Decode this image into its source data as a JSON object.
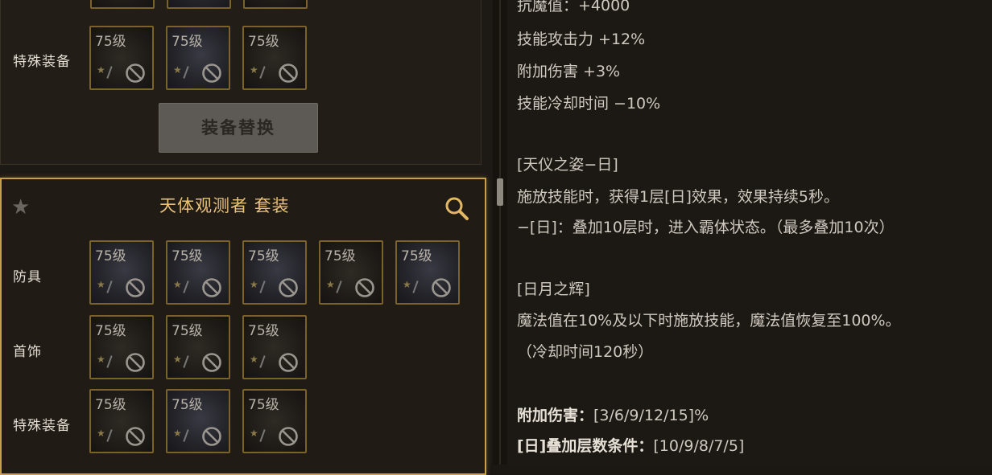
{
  "left_top": {
    "special_label": "特殊装备",
    "special_slots": [
      "75级",
      "75级",
      "75级"
    ],
    "swap_button": "装备替换"
  },
  "set_panel": {
    "title": "天体观测者 套装",
    "armor_label": "防具",
    "armor_slots": [
      "75级",
      "75级",
      "75级",
      "75级",
      "75级"
    ],
    "accessory_label": "首饰",
    "accessory_slots": [
      "75级",
      "75级",
      "75级"
    ],
    "special_label": "特殊装备",
    "special_slots": [
      "75级",
      "75级",
      "75级"
    ]
  },
  "description": {
    "lines": [
      "抗魔值：+4000",
      "技能攻击力 +12%",
      "附加伤害 +3%",
      "技能冷却时间 −10%",
      "[天仪之姿−日]",
      "施放技能时，获得1层[日]效果，效果持续5秒。",
      "−[日]：叠加10层时，进入霸体状态。（最多叠加10次）",
      "[日月之辉]",
      "魔法值在10%及以下时施放技能，魔法值恢复至100%。",
      "（冷却时间120秒）"
    ],
    "extra_damage_label": "附加伤害：",
    "extra_damage_value": "[3/6/9/12/15]%",
    "stack_label": "[日]叠加层数条件：",
    "stack_value": "[10/9/8/7/5]"
  },
  "icons": {
    "ban": "ban-icon",
    "star": "star-icon",
    "search": "search-icon",
    "favorite": "favorite-star-icon"
  },
  "colors": {
    "gold_border": "#c8a04a",
    "title": "#e9c27a",
    "slot_border": "#7a6228"
  }
}
